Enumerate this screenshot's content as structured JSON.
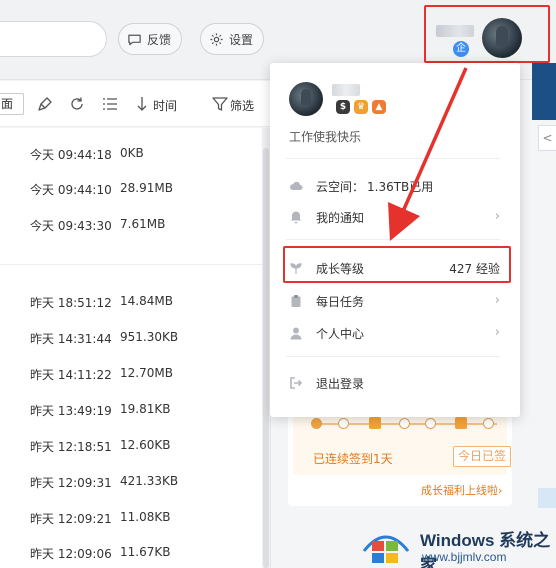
{
  "header": {
    "feedback_label": "反馈",
    "settings_label": "设置",
    "vip_badge_glyph": "企",
    "icons": {
      "feedback": "chat-bubble-icon",
      "settings": "gear-icon"
    }
  },
  "toolbar": {
    "view_tag": "面",
    "time_sort_label": "时间",
    "filter_label": "筛选",
    "icons": [
      "clean-brush-icon",
      "refresh-icon",
      "list-view-icon",
      "sort-down-icon",
      "filter-icon"
    ]
  },
  "files": [
    {
      "time": "今天 09:44:18",
      "size": "0KB"
    },
    {
      "time": "今天 09:44:10",
      "size": "28.91MB"
    },
    {
      "time": "今天 09:43:30",
      "size": "7.61MB"
    },
    {
      "time": "昨天 18:51:12",
      "size": "14.84MB"
    },
    {
      "time": "昨天 14:31:44",
      "size": "951.30KB"
    },
    {
      "time": "昨天 14:11:22",
      "size": "12.70MB"
    },
    {
      "time": "昨天 13:49:19",
      "size": "19.81KB"
    },
    {
      "time": "昨天 12:18:51",
      "size": "12.60KB"
    },
    {
      "time": "昨天 12:09:31",
      "size": "421.33KB"
    },
    {
      "time": "昨天 12:09:21",
      "size": "11.08KB"
    },
    {
      "time": "昨天 12:09:06",
      "size": "11.67KB"
    }
  ],
  "dropdown": {
    "signature": "工作使我快乐",
    "medals": [
      {
        "glyph": "$",
        "color": "#3a3a3a"
      },
      {
        "glyph": "♛",
        "color": "#f0a030"
      },
      {
        "glyph": "▲",
        "color": "#f07a30"
      }
    ],
    "cloud_label": "云空间：",
    "cloud_value": "1.36TB已用",
    "notify_label": "我的通知",
    "growth_label": "成长等级",
    "growth_value": "427 经验",
    "tasks_label": "每日任务",
    "profile_label": "个人中心",
    "logout_label": "退出登录",
    "chevron": "›",
    "icons": [
      "cloud-icon",
      "bell-icon",
      "sprout-icon",
      "clipboard-icon",
      "person-icon",
      "logout-icon"
    ]
  },
  "side_panel": {
    "sign_streak": "已连续签到1天",
    "sign_button": "今日已签",
    "growth_link": "成长福利上线啦›",
    "tab_arrow": "<"
  },
  "watermark": {
    "title": "Windows 系统之家",
    "url": "www.bjjmlv.com"
  },
  "colors": {
    "highlight": "#e5322d",
    "accent_orange": "#e07a1f",
    "vip_blue": "#3d8ef0"
  }
}
